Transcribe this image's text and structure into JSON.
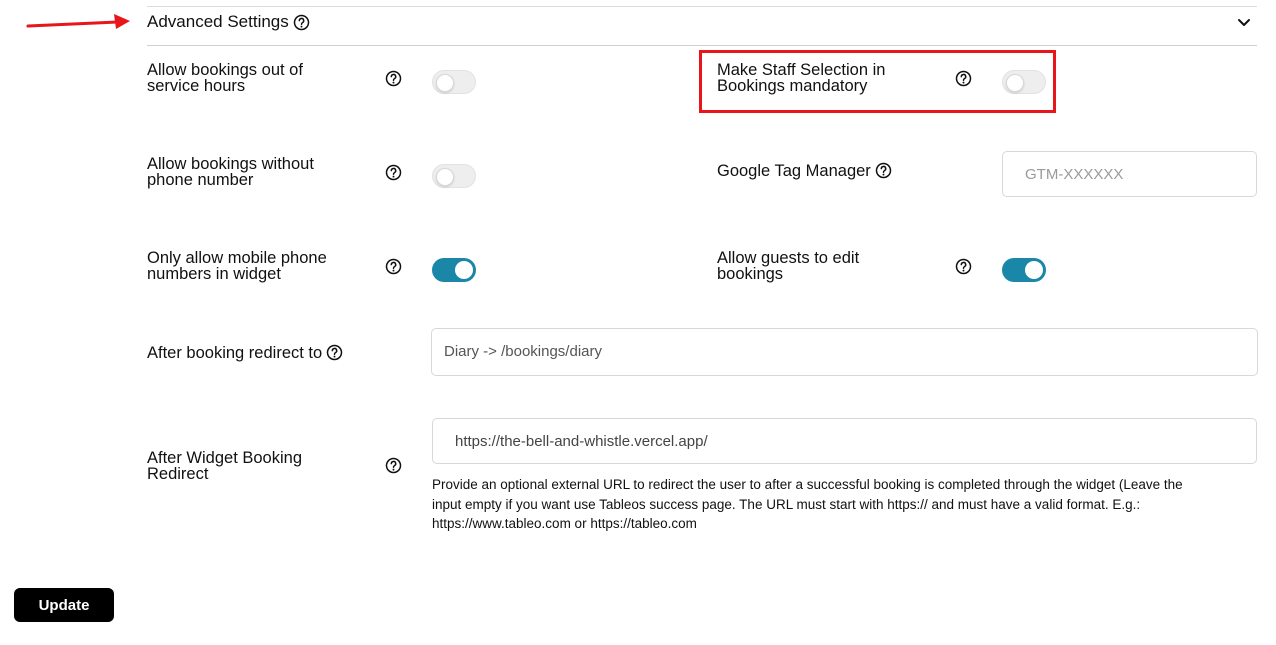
{
  "section": {
    "title": "Advanced Settings"
  },
  "settings": {
    "out_of_hours": {
      "label_line1": "Allow bookings out of",
      "label_line2": "service hours",
      "enabled": false
    },
    "staff_mandatory": {
      "label_line1": "Make Staff Selection in",
      "label_line2": "Bookings mandatory",
      "enabled": false
    },
    "without_phone": {
      "label_line1": "Allow bookings without",
      "label_line2": "phone number",
      "enabled": false
    },
    "gtm": {
      "label": "Google Tag Manager",
      "placeholder": "GTM-XXXXXX",
      "value": ""
    },
    "mobile_only": {
      "label_line1": "Only allow mobile phone",
      "label_line2": "numbers in widget",
      "enabled": true
    },
    "guests_edit": {
      "label_line1": "Allow guests to edit",
      "label_line2": "bookings",
      "enabled": true
    },
    "redirect": {
      "label": "After booking redirect to",
      "value": "Diary -> /bookings/diary"
    },
    "widget_redirect": {
      "label_line1": "After Widget Booking",
      "label_line2": "Redirect",
      "value": "https://the-bell-and-whistle.vercel.app/",
      "help_line1": "Provide an optional external URL to redirect the user to after a successful booking is completed through the widget (Leave the",
      "help_line2": "input empty if you want use Tableos success page. The URL must start with https:// and must have a valid format. E.g.:",
      "help_line3": "https://www.tableo.com or https://tableo.com"
    }
  },
  "actions": {
    "update_label": "Update"
  },
  "colors": {
    "accent": "#1a86a8",
    "highlight": "#e8151a",
    "button": "#000000"
  }
}
